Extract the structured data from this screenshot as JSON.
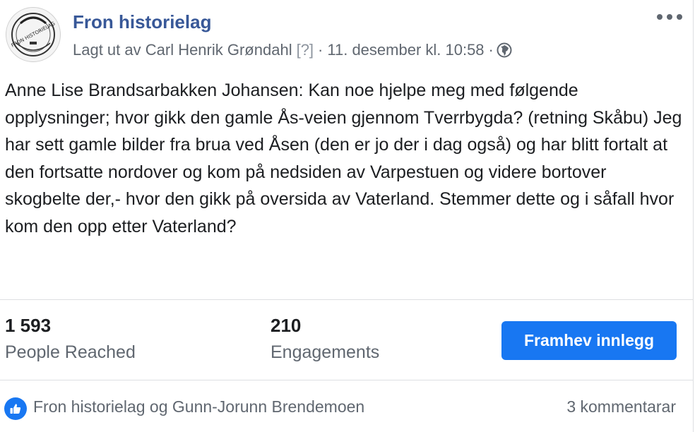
{
  "header": {
    "page_name": "Fron historielag",
    "posted_by": "Lagt ut av Carl Henrik Grøndahl",
    "unknown_tag": "[?]",
    "separator": "·",
    "timestamp": "11. desember kl. 10:58",
    "separator2": "·",
    "privacy_icon": "globe-icon",
    "more_icon": "more-dots-icon",
    "avatar_text": "FRON HISTORIELAG"
  },
  "post": {
    "text": "Anne Lise Brandsarbakken Johansen: Kan noe hjelpe meg med følgende opplysninger; hvor gikk den gamle Ås-veien gjennom Tverrbygda? (retning Skåbu) Jeg har sett gamle bilder fra brua ved Åsen (den er jo der i dag også) og har blitt fortalt at den fortsatte nordover og kom på nedsiden av Varpestuen og videre bortover skogbelte der,- hvor den gikk på oversida av Vaterland. Stemmer dette og i såfall hvor kom den opp etter Vaterland?"
  },
  "stats": {
    "reached_count": "1 593",
    "reached_label": "People Reached",
    "engagements_count": "210",
    "engagements_label": "Engagements",
    "boost_label": "Framhev innlegg"
  },
  "footer": {
    "like_icon": "thumbs-up-icon",
    "likers": "Fron historielag og Gunn-Jorunn Brendemoen",
    "comments": "3 kommentarar"
  },
  "colors": {
    "link_blue": "#385898",
    "button_blue": "#1877f2",
    "secondary_text": "#606770"
  }
}
